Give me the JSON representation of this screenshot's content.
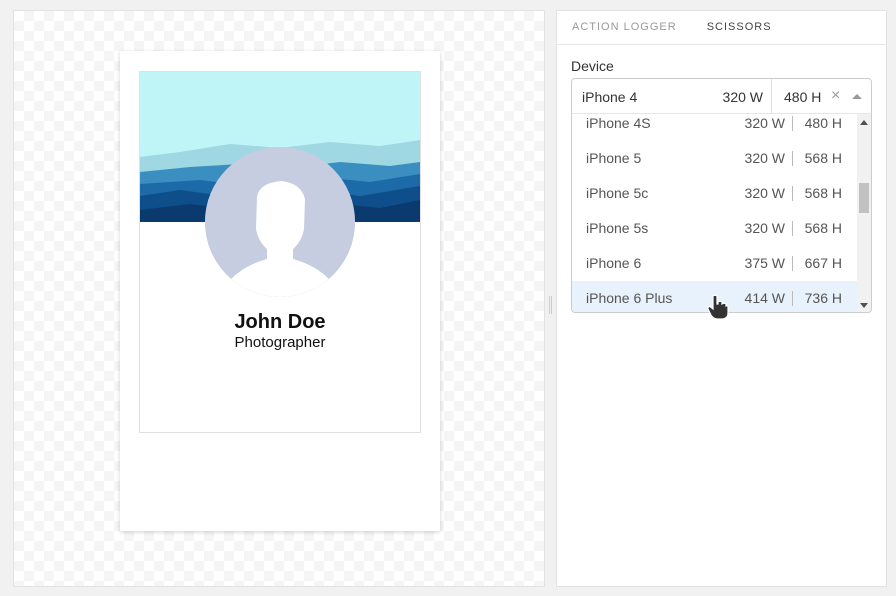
{
  "preview": {
    "profile": {
      "name": "John Doe",
      "title": "Photographer"
    }
  },
  "panel": {
    "tabs": [
      {
        "label": "ACTION LOGGER",
        "active": false
      },
      {
        "label": "SCISSORS",
        "active": true
      }
    ],
    "device_label": "Device",
    "selected": {
      "name": "iPhone 4",
      "width": "320 W",
      "height": "480 H"
    },
    "clear_glyph": "×",
    "options": [
      {
        "name": "iPhone 4S",
        "width": "320 W",
        "height": "480 H"
      },
      {
        "name": "iPhone 5",
        "width": "320 W",
        "height": "568 H"
      },
      {
        "name": "iPhone 5c",
        "width": "320 W",
        "height": "568 H"
      },
      {
        "name": "iPhone 5s",
        "width": "320 W",
        "height": "568 H"
      },
      {
        "name": "iPhone 6",
        "width": "375 W",
        "height": "667 H"
      },
      {
        "name": "iPhone 6 Plus",
        "width": "414 W",
        "height": "736 H",
        "highlighted": true
      }
    ]
  },
  "colors": {
    "avatar": "#c6cde0",
    "sky": "#bff5f6",
    "highlight": "#e8f2fc",
    "mountain_dark": "#0b3a6e"
  }
}
